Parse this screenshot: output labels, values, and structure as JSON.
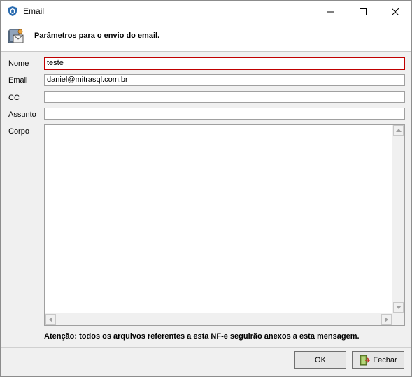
{
  "window": {
    "title": "Email",
    "title_icon": "app-shield-icon"
  },
  "header": {
    "text": "Parâmetros para o envio do email.",
    "icon": "email-settings-icon"
  },
  "form": {
    "nome_label": "Nome",
    "nome_value": "teste",
    "email_label": "Email",
    "email_value": "daniel@mitrasql.com.br",
    "cc_label": "CC",
    "cc_value": "",
    "assunto_label": "Assunto",
    "assunto_value": "",
    "corpo_label": "Corpo",
    "corpo_value": ""
  },
  "warning": "Atenção:  todos os arquivos referentes a esta NF-e seguirão anexos a esta mensagem.",
  "buttons": {
    "ok": "OK",
    "close": "Fechar"
  },
  "colors": {
    "focus_border": "#c00000",
    "accent": "#2b6cb0"
  }
}
